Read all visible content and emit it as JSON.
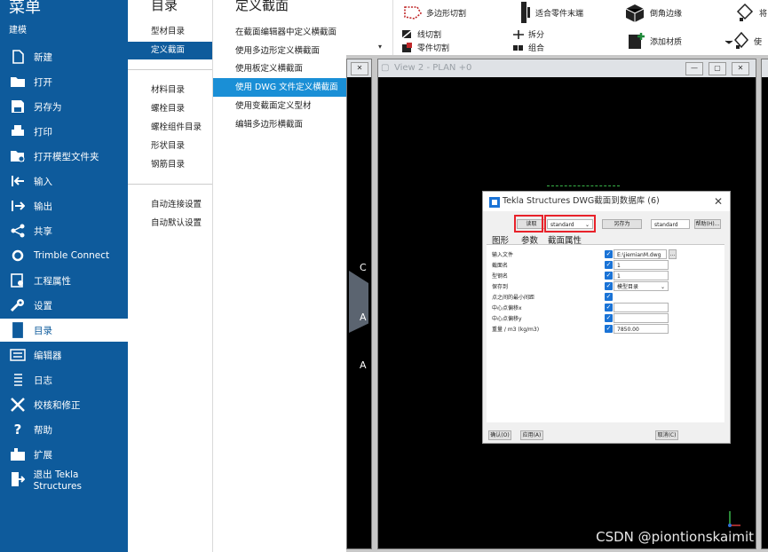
{
  "left_menu": {
    "title": "菜单",
    "subtitle": "建模",
    "items": [
      {
        "label": "新建",
        "icon": "new-file-icon"
      },
      {
        "label": "打开",
        "icon": "folder-icon"
      },
      {
        "label": "另存为",
        "icon": "save-icon"
      },
      {
        "label": "打印",
        "icon": "print-icon"
      },
      {
        "label": "打开模型文件夹",
        "icon": "open-folder-icon"
      },
      {
        "label": "输入",
        "icon": "import-icon"
      },
      {
        "label": "输出",
        "icon": "export-icon"
      },
      {
        "label": "共享",
        "icon": "share-icon"
      },
      {
        "label": "Trimble Connect",
        "icon": "trimble-connect-icon"
      },
      {
        "label": "工程属性",
        "icon": "project-properties-icon"
      },
      {
        "label": "设置",
        "icon": "settings-icon"
      },
      {
        "label": "目录",
        "icon": "catalog-icon"
      },
      {
        "label": "编辑器",
        "icon": "editor-icon"
      },
      {
        "label": "日志",
        "icon": "log-icon"
      },
      {
        "label": "校核和修正",
        "icon": "check-tools-icon"
      },
      {
        "label": "帮助",
        "icon": "help-icon"
      },
      {
        "label": "扩展",
        "icon": "extensions-icon"
      },
      {
        "label": "退出 Tekla Structures",
        "icon": "exit-icon"
      }
    ]
  },
  "catalog": {
    "title": "目录",
    "items": [
      "型材目录",
      "定义截面",
      "材料目录",
      "螺栓目录",
      "螺栓组件目录",
      "形状目录",
      "钢筋目录",
      "自动连接设置",
      "自动默认设置"
    ]
  },
  "submenu": {
    "title": "定义截面",
    "items": [
      "在截面编辑器中定义横截面",
      "使用多边形定义横截面",
      "使用板定义横截面",
      "使用 DWG 文件定义横截面",
      "使用变截面定义型材",
      "编辑多边形横截面"
    ]
  },
  "ribbon": {
    "polygon_cut": "多边形切割",
    "fit_part_end": "适合零件末端",
    "chamfer_edges": "倒角边缘",
    "line_cut": "线切割",
    "split": "拆分",
    "part_cut": "零件切割",
    "combine": "组合",
    "add_material": "添加材质",
    "right_top": "将",
    "right_bottom": "使"
  },
  "view": {
    "title": "View 2 - PLAN +0",
    "left_marks": [
      "C",
      "A",
      "A"
    ]
  },
  "dialog": {
    "title": "Tekla Structures  DWG截面到数据库 (6)",
    "load_button": "读取",
    "preset_value": "standard",
    "save_as_button": "另存为",
    "save_as_value": "standard",
    "help_button": "帮助(H)...",
    "tabs": [
      "图形",
      "参数",
      "截面属性"
    ],
    "params": [
      {
        "label": "输入文件",
        "value": "E:\\jiemianM.dwg",
        "kind": "file"
      },
      {
        "label": "截面名",
        "value": "1",
        "kind": "text"
      },
      {
        "label": "型钢名",
        "value": "1",
        "kind": "text"
      },
      {
        "label": "保存到",
        "value": "模型目录",
        "kind": "select"
      },
      {
        "label": "点之间的最小间距",
        "value": "",
        "kind": "none"
      },
      {
        "label": "中心点偏移x",
        "value": "",
        "kind": "text"
      },
      {
        "label": "中心点偏移y",
        "value": "",
        "kind": "text"
      },
      {
        "label": "重量 / m3 (kg/m3)",
        "value": "7850.00",
        "kind": "text"
      }
    ],
    "ok_button": "确认(O)",
    "apply_button": "应用(A)",
    "cancel_button": "取消(C)"
  },
  "watermark": "CSDN @piontionskaimit",
  "colors": {
    "menu_blue": "#0e5b9c",
    "active_submenu": "#1a8fd6",
    "highlight_red": "#e8222a"
  }
}
